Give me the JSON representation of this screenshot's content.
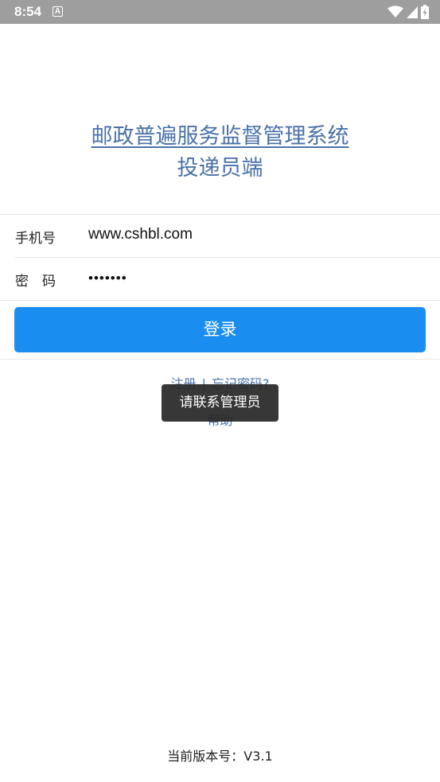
{
  "status_bar": {
    "time": "8:54",
    "notification_glyph": "A",
    "icons": [
      "wifi-icon",
      "signal-icon",
      "battery-icon"
    ]
  },
  "title": {
    "line1": "邮政普遍服务监督管理系统",
    "line2": "投递员端"
  },
  "form": {
    "phone_label": "手机号",
    "phone_value": "www.cshbl.com",
    "password_label": "密　码",
    "password_value": "•••••••"
  },
  "login_button": "登录",
  "links": {
    "register": "注册",
    "separator": "|",
    "forgot_password": "忘记密码?",
    "help": "帮助"
  },
  "toast": "请联系管理员",
  "version": "当前版本号：V3.1",
  "colors": {
    "status_bar": "#9e9e9e",
    "title": "#4a72a8",
    "button": "#1a8ef0",
    "toast_bg": "#282828"
  }
}
